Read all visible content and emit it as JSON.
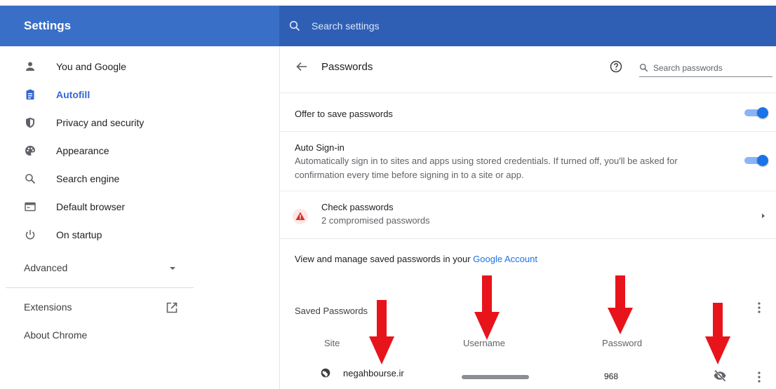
{
  "header": {
    "app_title": "Settings",
    "search_placeholder": "Search settings"
  },
  "sidebar": {
    "items": [
      {
        "label": "You and Google",
        "icon": "person-icon"
      },
      {
        "label": "Autofill",
        "icon": "clipboard-icon",
        "active": true
      },
      {
        "label": "Privacy and security",
        "icon": "shield-icon"
      },
      {
        "label": "Appearance",
        "icon": "palette-icon"
      },
      {
        "label": "Search engine",
        "icon": "search-icon"
      },
      {
        "label": "Default browser",
        "icon": "browser-icon"
      },
      {
        "label": "On startup",
        "icon": "power-icon"
      }
    ],
    "advanced_label": "Advanced",
    "extensions_label": "Extensions",
    "about_label": "About Chrome"
  },
  "main": {
    "title": "Passwords",
    "search_passwords_placeholder": "Search passwords",
    "offer_to_save": {
      "label": "Offer to save passwords",
      "enabled": true
    },
    "auto_sign_in": {
      "label": "Auto Sign-in",
      "description": "Automatically sign in to sites and apps using stored credentials. If turned off, you'll be asked for confirmation every time before signing in to a site or app.",
      "enabled": true
    },
    "check_passwords": {
      "title": "Check passwords",
      "subtitle": "2 compromised passwords"
    },
    "manage_text_prefix": "View and manage saved passwords in your ",
    "manage_link": "Google Account",
    "saved_passwords_title": "Saved Passwords",
    "columns": {
      "site": "Site",
      "username": "Username",
      "password": "Password"
    },
    "saved": [
      {
        "site": "negahbourse.ir",
        "username": "",
        "password": "968"
      }
    ]
  },
  "colors": {
    "header_left": "#3a6fc7",
    "header_right": "#2f5fb5",
    "accent": "#1a73e8",
    "annotation_arrow": "#e8141c"
  }
}
